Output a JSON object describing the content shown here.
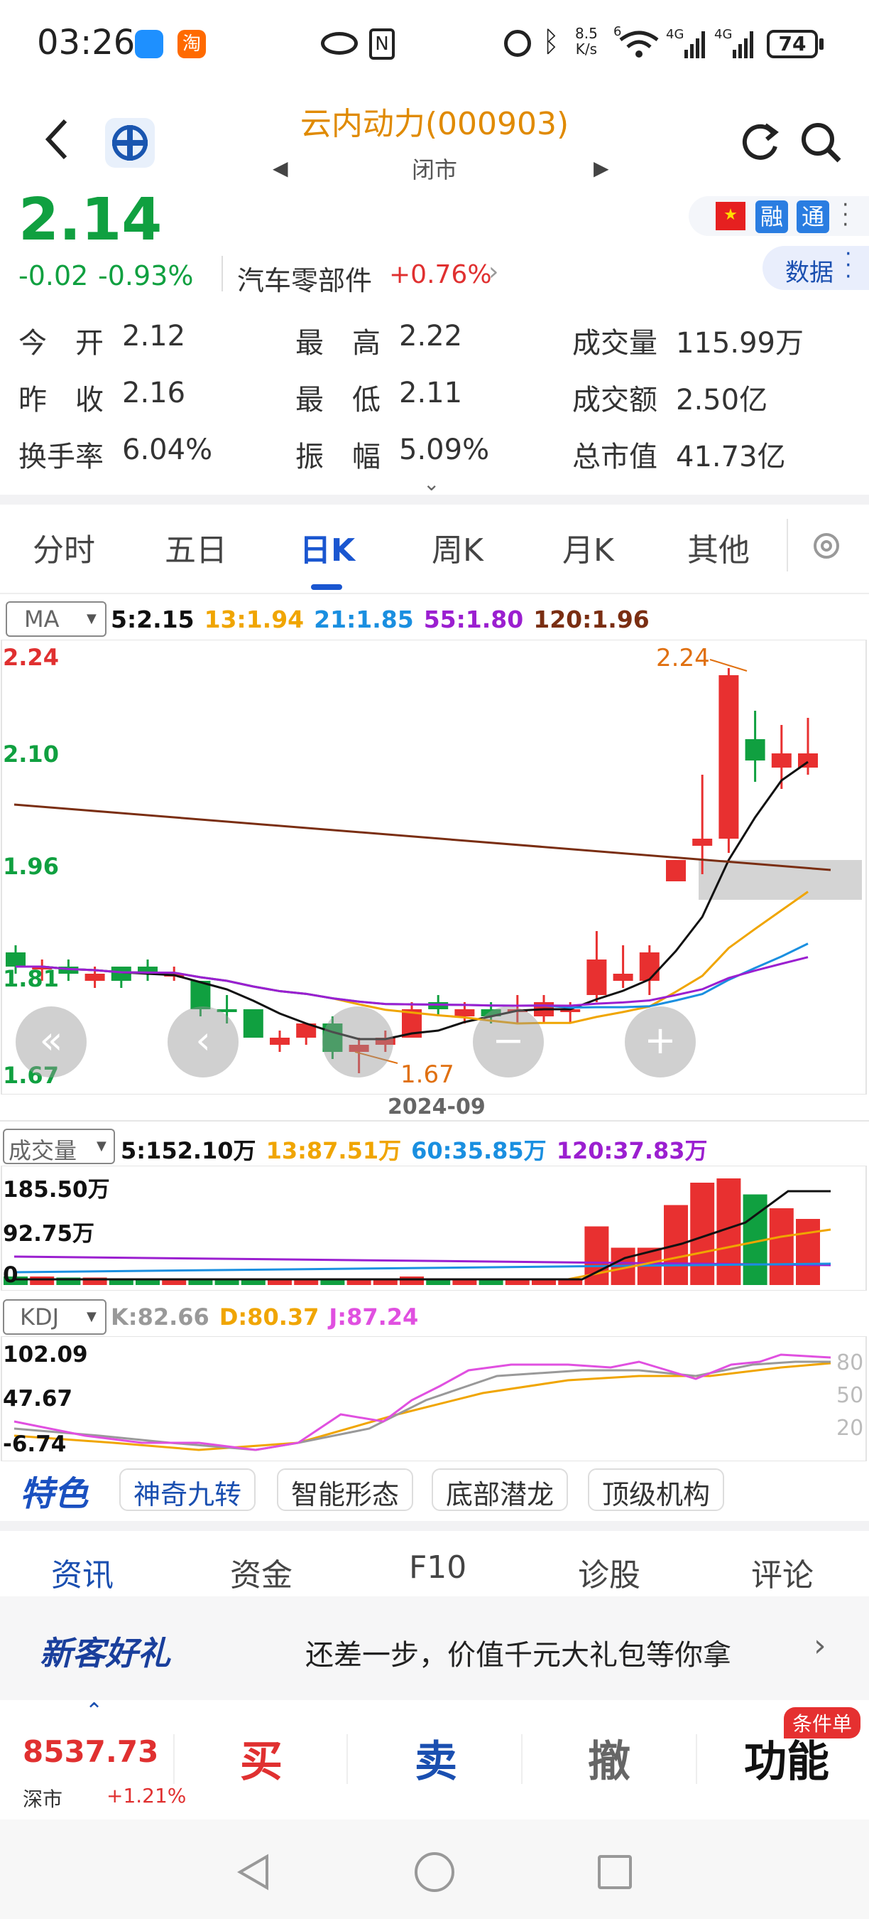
{
  "status_bar": {
    "time": "03:26",
    "net_speed_top": "8.5",
    "net_speed_bottom": "K/s",
    "battery": "74",
    "signal1": "4G",
    "signal2": "4G",
    "wifi_badge": "6"
  },
  "header": {
    "title": "云内动力(000903)",
    "market_status": "闭市"
  },
  "quote": {
    "price": "2.14",
    "change": "-0.02",
    "change_pct": "-0.93%",
    "sector": "汽车零部件",
    "sector_change": "+0.76%",
    "badges": [
      "融",
      "通"
    ],
    "data_btn": "数据"
  },
  "stats": [
    {
      "label": "今　开",
      "value": "2.12"
    },
    {
      "label": "最　高",
      "value": "2.22"
    },
    {
      "label": "成交量",
      "value": "115.99万"
    },
    {
      "label": "昨　收",
      "value": "2.16"
    },
    {
      "label": "最　低",
      "value": "2.11"
    },
    {
      "label": "成交额",
      "value": "2.50亿"
    },
    {
      "label": "换手率",
      "value": "6.04%"
    },
    {
      "label": "振　幅",
      "value": "5.09%"
    },
    {
      "label": "总市值",
      "value": "41.73亿"
    }
  ],
  "chart_tabs": [
    "分时",
    "五日",
    "日K",
    "周K",
    "月K",
    "其他"
  ],
  "ma": {
    "selector": "MA",
    "items": [
      {
        "text": "5:2.15",
        "color": "#111111"
      },
      {
        "text": "13:1.94",
        "color": "#f0a500"
      },
      {
        "text": "21:1.85",
        "color": "#1a8fe0"
      },
      {
        "text": "55:1.80",
        "color": "#9b1fd0"
      },
      {
        "text": "120:1.96",
        "color": "#7a2e12"
      }
    ]
  },
  "price_axis": {
    "top": "2.24",
    "l2": "2.10",
    "l3": "1.96",
    "l4": "1.81",
    "bottom": "1.67"
  },
  "chart_data": {
    "type": "candlestick",
    "date_label": "2024-09",
    "high_annotation": "2.24",
    "low_annotation": "1.67",
    "candles": [
      {
        "o": 1.84,
        "c": 1.82,
        "h": 1.85,
        "l": 1.81,
        "up": false
      },
      {
        "o": 1.82,
        "c": 1.82,
        "h": 1.83,
        "l": 1.8,
        "up": true
      },
      {
        "o": 1.82,
        "c": 1.81,
        "h": 1.83,
        "l": 1.8,
        "up": false
      },
      {
        "o": 1.8,
        "c": 1.81,
        "h": 1.82,
        "l": 1.79,
        "up": true
      },
      {
        "o": 1.82,
        "c": 1.8,
        "h": 1.82,
        "l": 1.79,
        "up": false
      },
      {
        "o": 1.82,
        "c": 1.81,
        "h": 1.83,
        "l": 1.8,
        "up": false
      },
      {
        "o": 1.81,
        "c": 1.81,
        "h": 1.82,
        "l": 1.8,
        "up": true
      },
      {
        "o": 1.8,
        "c": 1.76,
        "h": 1.8,
        "l": 1.75,
        "up": false
      },
      {
        "o": 1.76,
        "c": 1.76,
        "h": 1.78,
        "l": 1.74,
        "up": false
      },
      {
        "o": 1.76,
        "c": 1.72,
        "h": 1.76,
        "l": 1.72,
        "up": false
      },
      {
        "o": 1.71,
        "c": 1.72,
        "h": 1.73,
        "l": 1.7,
        "up": true
      },
      {
        "o": 1.72,
        "c": 1.74,
        "h": 1.74,
        "l": 1.71,
        "up": true
      },
      {
        "o": 1.74,
        "c": 1.7,
        "h": 1.75,
        "l": 1.69,
        "up": false
      },
      {
        "o": 1.7,
        "c": 1.71,
        "h": 1.72,
        "l": 1.67,
        "up": true
      },
      {
        "o": 1.71,
        "c": 1.72,
        "h": 1.73,
        "l": 1.7,
        "up": true
      },
      {
        "o": 1.72,
        "c": 1.76,
        "h": 1.77,
        "l": 1.72,
        "up": true
      },
      {
        "o": 1.77,
        "c": 1.76,
        "h": 1.78,
        "l": 1.75,
        "up": false
      },
      {
        "o": 1.75,
        "c": 1.76,
        "h": 1.77,
        "l": 1.74,
        "up": true
      },
      {
        "o": 1.76,
        "c": 1.75,
        "h": 1.77,
        "l": 1.74,
        "up": false
      },
      {
        "o": 1.76,
        "c": 1.76,
        "h": 1.78,
        "l": 1.74,
        "up": true
      },
      {
        "o": 1.75,
        "c": 1.77,
        "h": 1.78,
        "l": 1.74,
        "up": true
      },
      {
        "o": 1.76,
        "c": 1.76,
        "h": 1.77,
        "l": 1.74,
        "up": true
      },
      {
        "o": 1.78,
        "c": 1.83,
        "h": 1.87,
        "l": 1.77,
        "up": true
      },
      {
        "o": 1.8,
        "c": 1.81,
        "h": 1.85,
        "l": 1.79,
        "up": true
      },
      {
        "o": 1.8,
        "c": 1.84,
        "h": 1.85,
        "l": 1.78,
        "up": true
      },
      {
        "o": 1.94,
        "c": 1.97,
        "h": 1.97,
        "l": 1.94,
        "up": true
      },
      {
        "o": 1.99,
        "c": 2.0,
        "h": 2.09,
        "l": 1.95,
        "up": true
      },
      {
        "o": 2.0,
        "c": 2.23,
        "h": 2.24,
        "l": 1.98,
        "up": true
      },
      {
        "o": 2.14,
        "c": 2.11,
        "h": 2.18,
        "l": 2.08,
        "up": false
      },
      {
        "o": 2.12,
        "c": 2.1,
        "h": 2.16,
        "l": 2.07,
        "up": true
      },
      {
        "o": 2.12,
        "c": 2.1,
        "h": 2.17,
        "l": 2.09,
        "up": true
      }
    ]
  },
  "volume": {
    "selector": "成交量",
    "items": [
      {
        "text": "5:152.10万",
        "color": "#111111"
      },
      {
        "text": "13:87.51万",
        "color": "#f0a500"
      },
      {
        "text": "60:35.85万",
        "color": "#1a8fe0"
      },
      {
        "text": "120:37.83万",
        "color": "#9b1fd0"
      }
    ],
    "axis_top": "185.50万",
    "axis_mid": "92.75万",
    "axis_zero": "0",
    "bars": [
      8,
      8,
      7,
      7,
      6,
      6,
      6,
      5,
      5,
      5,
      5,
      5,
      5,
      5,
      5,
      8,
      6,
      6,
      5,
      6,
      5,
      6,
      55,
      35,
      35,
      75,
      96,
      100,
      85,
      72,
      62
    ]
  },
  "kdj": {
    "selector": "KDJ",
    "items": [
      {
        "text": "K:82.66",
        "color": "#999999"
      },
      {
        "text": "D:80.37",
        "color": "#f0a500"
      },
      {
        "text": "J:87.24",
        "color": "#e050e0"
      }
    ],
    "axis_top": "102.09",
    "axis_mid": "47.67",
    "axis_low": "-6.74",
    "right_marks": [
      "80",
      "50",
      "20"
    ]
  },
  "features": {
    "badge": "特色",
    "items": [
      "神奇九转",
      "智能形态",
      "底部潜龙",
      "顶级机构"
    ]
  },
  "sub_tabs": [
    "资讯",
    "资金",
    "F10",
    "诊股",
    "评论"
  ],
  "promo": {
    "logo": "新客好礼",
    "text": "还差一步，价值千元大礼包等你拿"
  },
  "footer": {
    "index_value": "8537.73",
    "index_name": "深市",
    "index_change": "+1.21%",
    "buy": "买",
    "sell": "卖",
    "cancel": "撤",
    "func": "功能",
    "func_badge": "条件单"
  }
}
